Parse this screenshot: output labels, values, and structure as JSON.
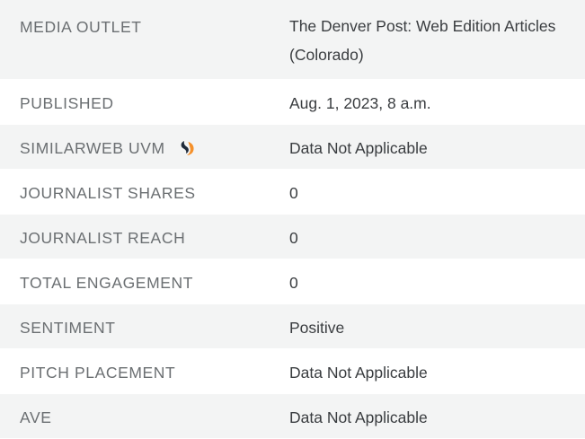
{
  "rows": [
    {
      "label": "MEDIA OUTLET",
      "value": "The Denver Post: Web Edition Articles (Colorado)"
    },
    {
      "label": "PUBLISHED",
      "value": "Aug. 1, 2023, 8 a.m."
    },
    {
      "label": "SIMILARWEB UVM",
      "value": "Data Not Applicable",
      "icon": "similarweb-icon"
    },
    {
      "label": "JOURNALIST SHARES",
      "value": "0"
    },
    {
      "label": "JOURNALIST REACH",
      "value": "0"
    },
    {
      "label": "TOTAL ENGAGEMENT",
      "value": "0"
    },
    {
      "label": "SENTIMENT",
      "value": "Positive"
    },
    {
      "label": "PITCH PLACEMENT",
      "value": "Data Not Applicable"
    },
    {
      "label": "AVE",
      "value": "Data Not Applicable"
    }
  ],
  "colors": {
    "row_alt_bg": "#f3f4f4",
    "label_text": "#6b6f72",
    "value_text": "#3a3d40",
    "similarweb_orange": "#f5902a",
    "similarweb_dark": "#1e2a3a"
  }
}
